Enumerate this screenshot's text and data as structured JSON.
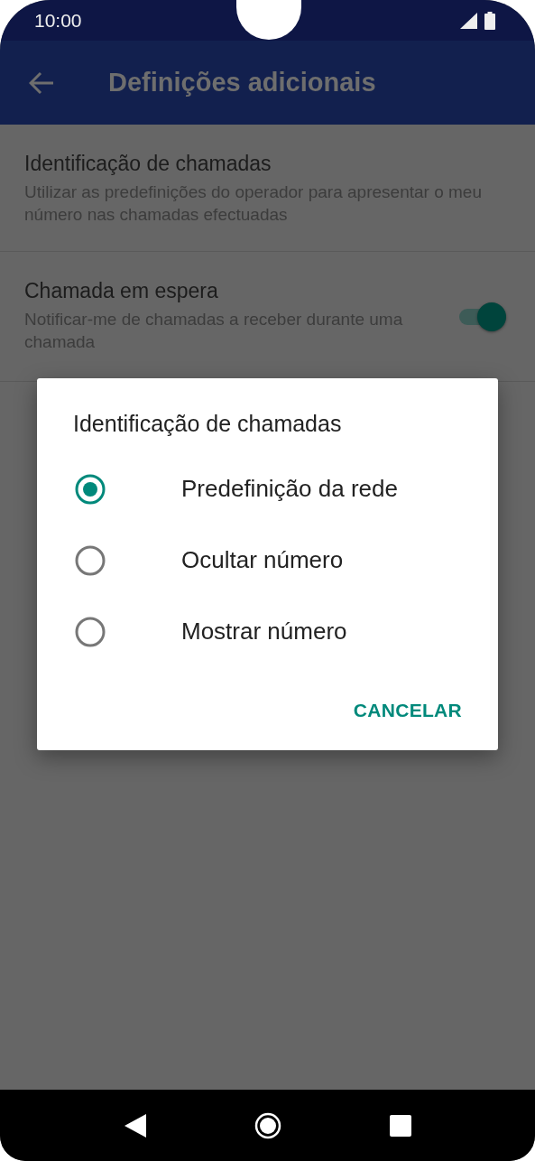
{
  "status_bar": {
    "time": "10:00"
  },
  "app_bar": {
    "title": "Definições adicionais"
  },
  "settings": [
    {
      "kind": "text",
      "title": "Identificação de chamadas",
      "subtitle": "Utilizar as predefinições do operador para apresentar o meu número nas chamadas efectuadas"
    },
    {
      "kind": "switch",
      "title": "Chamada em espera",
      "subtitle": "Notificar-me de chamadas a receber durante uma chamada",
      "on": true
    }
  ],
  "dialog": {
    "title": "Identificação de chamadas",
    "options": [
      {
        "label": "Predefinição da rede",
        "selected": true
      },
      {
        "label": "Ocultar número",
        "selected": false
      },
      {
        "label": "Mostrar número",
        "selected": false
      }
    ],
    "buttons": [
      "CANCELAR"
    ]
  }
}
